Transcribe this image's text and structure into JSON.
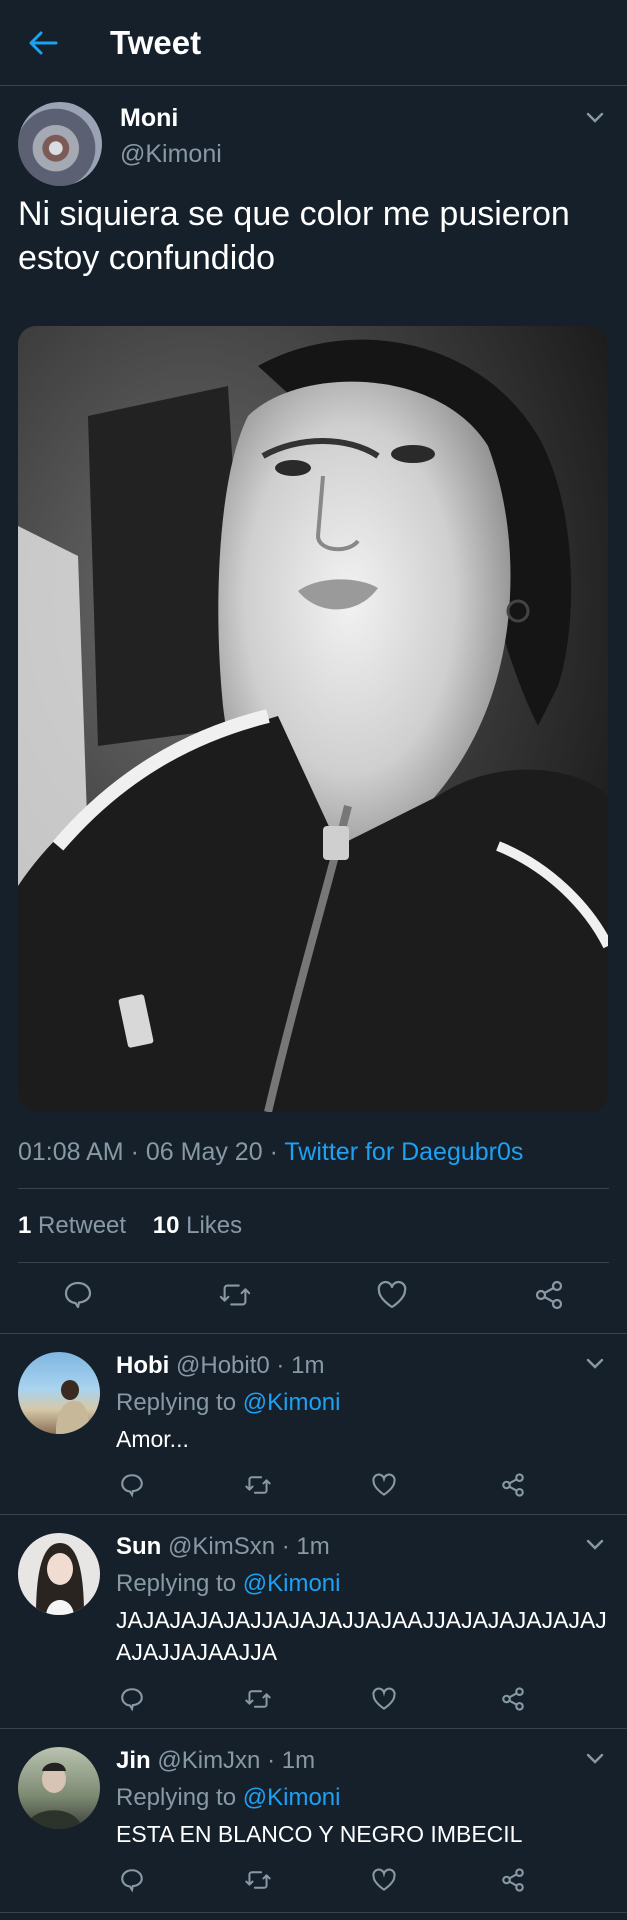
{
  "header": {
    "title": "Tweet"
  },
  "tweet": {
    "author_name": "Moni",
    "author_handle": "@Kimoni",
    "text": "Ni siquiera se que color me pusieron estoy confundido",
    "time": "01:08 AM",
    "date": "06 May 20",
    "separator": "·",
    "source": "Twitter for Daegubr0s",
    "retweet_count": "1",
    "retweet_label": "Retweet",
    "like_count": "10",
    "like_label": "Likes"
  },
  "replies": [
    {
      "name": "Hobi",
      "handle": "@Hobit0",
      "time": "1m",
      "replying_label": "Replying to",
      "mention": "@Kimoni",
      "text": "Amor..."
    },
    {
      "name": "Sun",
      "handle": "@KimSxn",
      "time": "1m",
      "replying_label": "Replying to",
      "mention": "@Kimoni",
      "text": "JAJAJAJAJAJJAJAJAJJAJAAJJAJAJAJAJAJAJAJAJJAJAAJJA"
    },
    {
      "name": "Jin",
      "handle": "@KimJxn",
      "time": "1m",
      "replying_label": "Replying to",
      "mention": "@Kimoni",
      "text": "ESTA EN BLANCO Y NEGRO IMBECIL"
    }
  ],
  "icons": [
    "back-arrow-icon",
    "chevron-down-icon",
    "reply-icon",
    "retweet-icon",
    "like-icon",
    "share-icon"
  ],
  "colors": {
    "background": "#15202b",
    "accent": "#1da1f2",
    "secondary_text": "#8899a6",
    "divider": "#38444d"
  }
}
